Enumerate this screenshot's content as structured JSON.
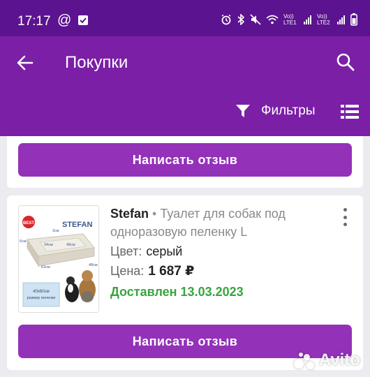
{
  "status_bar": {
    "time": "17:17",
    "sim1_label": "Vo)) LTE1",
    "sim2_label": "Vo)) LTE2"
  },
  "app_bar": {
    "title": "Покупки",
    "back_icon": "arrow-left-icon",
    "search_icon": "search-icon"
  },
  "filter_bar": {
    "filter_label": "Фильтры",
    "filter_icon": "filter-funnel-icon",
    "view_icon": "list-view-icon"
  },
  "orders": [
    {
      "review_label": "Написать отзыв"
    },
    {
      "brand": "Stefan",
      "separator": "•",
      "product_name": "Туалет для собак под одноразовую пеленку L",
      "color_label": "Цвет:",
      "color_value": "серый",
      "price_label": "Цена:",
      "price_value": "1 687 ₽",
      "status": "Доставлен 13.03.2023",
      "review_label": "Написать отзыв",
      "thumbnail": {
        "brand_logo": "STEFAN",
        "badge": "BEST",
        "dim_top": "3см",
        "dim_inner1": "34см",
        "dim_inner2": "49см",
        "dim_left": "6см",
        "dim_bottom": "63см",
        "dim_right": "48см",
        "pad_size": "40x60см",
        "pad_caption": "размер пеленки"
      }
    }
  ],
  "watermark": "Avito",
  "colors": {
    "header": "#7a1fa6",
    "status_bar": "#5b1390",
    "button": "#9431b9",
    "delivered": "#3aa33f"
  }
}
